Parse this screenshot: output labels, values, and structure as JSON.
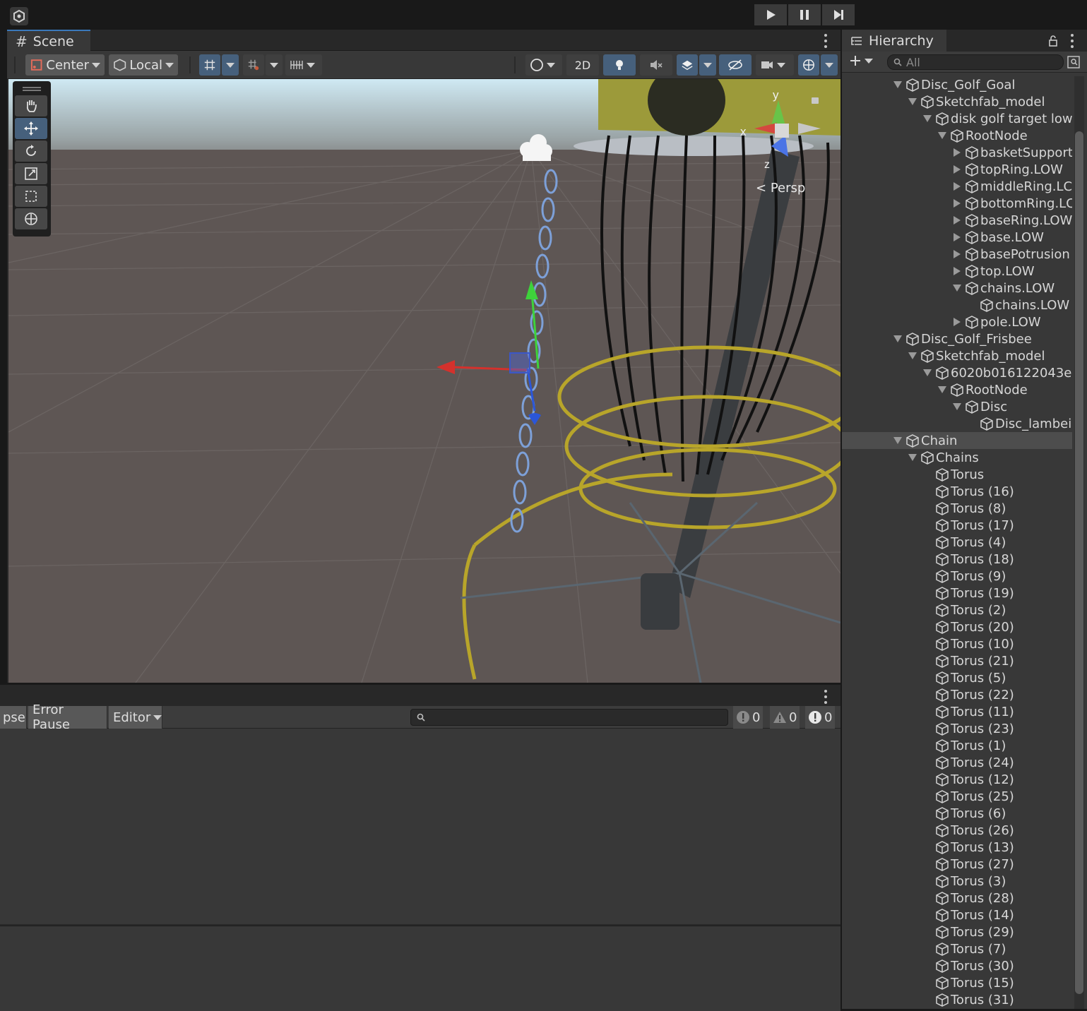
{
  "toolbar": {
    "play_icon": "play-icon",
    "pause_icon": "pause-icon",
    "step_icon": "step-icon"
  },
  "scene": {
    "tab_label": "Scene",
    "pivot_label": "Center",
    "space_label": "Local",
    "mode_2d_label": "2D",
    "persp_label": "Persp",
    "gizmo_axes": {
      "x": "x",
      "y": "y",
      "z": "z"
    }
  },
  "console": {
    "collapse_label": "pse",
    "error_pause_label": "Error Pause",
    "editor_label": "Editor",
    "log_count": "0",
    "warning_count": "0",
    "error_count": "0"
  },
  "hierarchy": {
    "tab_label": "Hierarchy",
    "search_placeholder": "All",
    "items": [
      {
        "label": "Disc_Golf_Goal",
        "depth": 0,
        "expand": "down"
      },
      {
        "label": "Sketchfab_model",
        "depth": 1,
        "expand": "down"
      },
      {
        "label": "disk golf target low",
        "depth": 2,
        "expand": "down"
      },
      {
        "label": "RootNode",
        "depth": 3,
        "expand": "down"
      },
      {
        "label": "basketSupport",
        "depth": 4,
        "expand": "right"
      },
      {
        "label": "topRing.LOW",
        "depth": 4,
        "expand": "right"
      },
      {
        "label": "middleRing.LC",
        "depth": 4,
        "expand": "right"
      },
      {
        "label": "bottomRing.LC",
        "depth": 4,
        "expand": "right"
      },
      {
        "label": "baseRing.LOW",
        "depth": 4,
        "expand": "right"
      },
      {
        "label": "base.LOW",
        "depth": 4,
        "expand": "right"
      },
      {
        "label": "basePotrusion",
        "depth": 4,
        "expand": "right"
      },
      {
        "label": "top.LOW",
        "depth": 4,
        "expand": "right"
      },
      {
        "label": "chains.LOW",
        "depth": 4,
        "expand": "down"
      },
      {
        "label": "chains.LOW",
        "depth": 5,
        "expand": "none"
      },
      {
        "label": "pole.LOW",
        "depth": 4,
        "expand": "right"
      },
      {
        "label": "Disc_Golf_Frisbee",
        "depth": 0,
        "expand": "down"
      },
      {
        "label": "Sketchfab_model",
        "depth": 1,
        "expand": "down"
      },
      {
        "label": "6020b016122043e",
        "depth": 2,
        "expand": "down"
      },
      {
        "label": "RootNode",
        "depth": 3,
        "expand": "down"
      },
      {
        "label": "Disc",
        "depth": 4,
        "expand": "down"
      },
      {
        "label": "Disc_lambei",
        "depth": 5,
        "expand": "none"
      },
      {
        "label": "Chain",
        "depth": 0,
        "expand": "down",
        "selected": true
      },
      {
        "label": "Chains",
        "depth": 1,
        "expand": "down"
      },
      {
        "label": "Torus",
        "depth": 2,
        "expand": "none"
      },
      {
        "label": "Torus (16)",
        "depth": 2,
        "expand": "none"
      },
      {
        "label": "Torus (8)",
        "depth": 2,
        "expand": "none"
      },
      {
        "label": "Torus (17)",
        "depth": 2,
        "expand": "none"
      },
      {
        "label": "Torus (4)",
        "depth": 2,
        "expand": "none"
      },
      {
        "label": "Torus (18)",
        "depth": 2,
        "expand": "none"
      },
      {
        "label": "Torus (9)",
        "depth": 2,
        "expand": "none"
      },
      {
        "label": "Torus (19)",
        "depth": 2,
        "expand": "none"
      },
      {
        "label": "Torus (2)",
        "depth": 2,
        "expand": "none"
      },
      {
        "label": "Torus (20)",
        "depth": 2,
        "expand": "none"
      },
      {
        "label": "Torus (10)",
        "depth": 2,
        "expand": "none"
      },
      {
        "label": "Torus (21)",
        "depth": 2,
        "expand": "none"
      },
      {
        "label": "Torus (5)",
        "depth": 2,
        "expand": "none"
      },
      {
        "label": "Torus (22)",
        "depth": 2,
        "expand": "none"
      },
      {
        "label": "Torus (11)",
        "depth": 2,
        "expand": "none"
      },
      {
        "label": "Torus (23)",
        "depth": 2,
        "expand": "none"
      },
      {
        "label": "Torus (1)",
        "depth": 2,
        "expand": "none"
      },
      {
        "label": "Torus (24)",
        "depth": 2,
        "expand": "none"
      },
      {
        "label": "Torus (12)",
        "depth": 2,
        "expand": "none"
      },
      {
        "label": "Torus (25)",
        "depth": 2,
        "expand": "none"
      },
      {
        "label": "Torus (6)",
        "depth": 2,
        "expand": "none"
      },
      {
        "label": "Torus (26)",
        "depth": 2,
        "expand": "none"
      },
      {
        "label": "Torus (13)",
        "depth": 2,
        "expand": "none"
      },
      {
        "label": "Torus (27)",
        "depth": 2,
        "expand": "none"
      },
      {
        "label": "Torus (3)",
        "depth": 2,
        "expand": "none"
      },
      {
        "label": "Torus (28)",
        "depth": 2,
        "expand": "none"
      },
      {
        "label": "Torus (14)",
        "depth": 2,
        "expand": "none"
      },
      {
        "label": "Torus (29)",
        "depth": 2,
        "expand": "none"
      },
      {
        "label": "Torus (7)",
        "depth": 2,
        "expand": "none"
      },
      {
        "label": "Torus (30)",
        "depth": 2,
        "expand": "none"
      },
      {
        "label": "Torus (15)",
        "depth": 2,
        "expand": "none"
      },
      {
        "label": "Torus (31)",
        "depth": 2,
        "expand": "none"
      }
    ]
  },
  "colors": {
    "accent": "#3a79bb",
    "panel": "#383838",
    "selected_row": "#4d4d4d",
    "basket_yellow": "#b5a22a"
  }
}
